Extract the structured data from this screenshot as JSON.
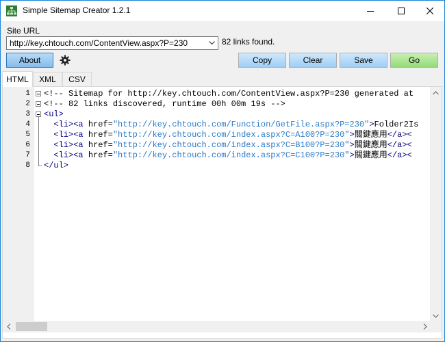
{
  "window": {
    "title": "Simple Sitemap Creator 1.2.1",
    "icon": "sitemap-app-icon",
    "controls": [
      "minimize-icon",
      "maximize-icon",
      "close-icon"
    ]
  },
  "site_url": {
    "label": "Site URL",
    "value": "http://key.chtouch.com/ContentView.aspx?P=230",
    "status": "82 links found."
  },
  "toolbar": {
    "about_label": "About",
    "settings_icon": "gear-icon",
    "copy_label": "Copy",
    "clear_label": "Clear",
    "save_label": "Save",
    "go_label": "Go"
  },
  "tabs": [
    {
      "label": "HTML",
      "active": true
    },
    {
      "label": "XML",
      "active": false
    },
    {
      "label": "CSV",
      "active": false
    }
  ],
  "editor": {
    "line_numbers": [
      "1",
      "2",
      "3",
      "4",
      "5",
      "6",
      "7",
      "8"
    ],
    "lines": [
      [
        {
          "t": "comment",
          "v": "<!-- Sitemap for http://key.chtouch.com/ContentView.aspx?P=230 generated at"
        }
      ],
      [
        {
          "t": "comment",
          "v": "<!-- 82 links discovered, runtime 00h 00m 19s -->"
        }
      ],
      [
        {
          "t": "tag",
          "v": "<ul>"
        }
      ],
      [
        {
          "t": "text",
          "v": "  "
        },
        {
          "t": "tag",
          "v": "<li><a "
        },
        {
          "t": "attr",
          "v": "href="
        },
        {
          "t": "str",
          "v": "\"http://key.chtouch.com/Function/GetFile.aspx?P=230\""
        },
        {
          "t": "tag",
          "v": ">"
        },
        {
          "t": "text",
          "v": "Folder2Is"
        }
      ],
      [
        {
          "t": "text",
          "v": "  "
        },
        {
          "t": "tag",
          "v": "<li><a "
        },
        {
          "t": "attr",
          "v": "href="
        },
        {
          "t": "str",
          "v": "\"http://key.chtouch.com/index.aspx?C=A100?P=230\""
        },
        {
          "t": "tag",
          "v": ">"
        },
        {
          "t": "text",
          "v": "關鍵應用"
        },
        {
          "t": "tag",
          "v": "</a><"
        }
      ],
      [
        {
          "t": "text",
          "v": "  "
        },
        {
          "t": "tag",
          "v": "<li><a "
        },
        {
          "t": "attr",
          "v": "href="
        },
        {
          "t": "str",
          "v": "\"http://key.chtouch.com/index.aspx?C=B100?P=230\""
        },
        {
          "t": "tag",
          "v": ">"
        },
        {
          "t": "text",
          "v": "關鍵應用"
        },
        {
          "t": "tag",
          "v": "</a><"
        }
      ],
      [
        {
          "t": "text",
          "v": "  "
        },
        {
          "t": "tag",
          "v": "<li><a "
        },
        {
          "t": "attr",
          "v": "href="
        },
        {
          "t": "str",
          "v": "\"http://key.chtouch.com/index.aspx?C=C100?P=230\""
        },
        {
          "t": "tag",
          "v": ">"
        },
        {
          "t": "text",
          "v": "關鍵應用"
        },
        {
          "t": "tag",
          "v": "</a><"
        }
      ],
      [
        {
          "t": "tag",
          "v": "</ul>"
        }
      ]
    ]
  },
  "colors": {
    "accent_border": "#1883d7",
    "button_blue": "#9fcef5",
    "button_green": "#92dc76",
    "string_color": "#2a7ac8",
    "tag_color": "#000080"
  }
}
